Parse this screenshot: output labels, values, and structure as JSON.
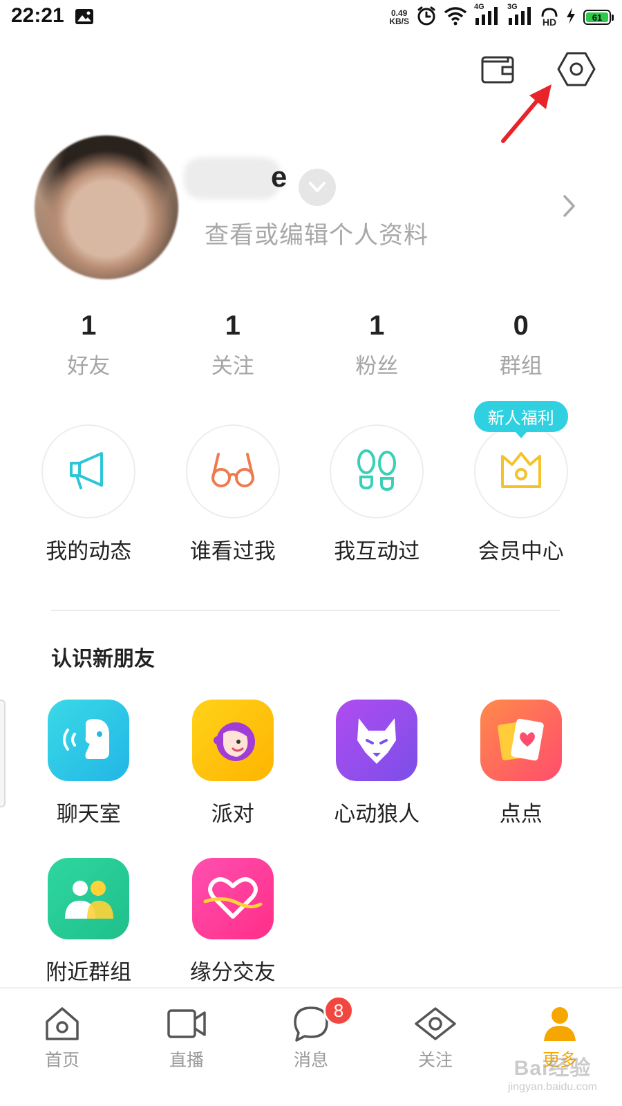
{
  "status_bar": {
    "time": "22:21",
    "net_speed_value": "0.49",
    "net_speed_unit": "KB/S",
    "network_1": "4G",
    "network_2": "3G",
    "hd_label": "HD",
    "battery": "61",
    "icons": [
      "image-icon",
      "alarm-icon",
      "wifi-icon",
      "signal-icon",
      "signal-icon",
      "hd-voice-icon",
      "charging-icon",
      "battery-icon"
    ]
  },
  "top_actions": {
    "icons": [
      "wallet-icon",
      "settings-icon"
    ]
  },
  "profile": {
    "name_visible_suffix": "e",
    "subtitle": "查看或编辑个人资料"
  },
  "stats": [
    {
      "value": "1",
      "label": "好友"
    },
    {
      "value": "1",
      "label": "关注"
    },
    {
      "value": "1",
      "label": "粉丝"
    },
    {
      "value": "0",
      "label": "群组"
    }
  ],
  "quick_actions": [
    {
      "label": "我的动态",
      "icon": "megaphone-icon",
      "color": "#2cc6d8"
    },
    {
      "label": "谁看过我",
      "icon": "glasses-icon",
      "color": "#ee7a4e"
    },
    {
      "label": "我互动过",
      "icon": "footprints-icon",
      "color": "#3ad0b8"
    },
    {
      "label": "会员中心",
      "icon": "crown-icon",
      "color": "#f5c22a",
      "badge": "新人福利"
    }
  ],
  "discover": {
    "title": "认识新朋友",
    "apps": [
      {
        "label": "聊天室",
        "icon": "chatroom-icon"
      },
      {
        "label": "派对",
        "icon": "party-icon"
      },
      {
        "label": "心动狼人",
        "icon": "werewolf-icon"
      },
      {
        "label": "点点",
        "icon": "cards-icon"
      },
      {
        "label": "附近群组",
        "icon": "nearby-groups-icon"
      },
      {
        "label": "缘分交友",
        "icon": "heart-match-icon"
      }
    ]
  },
  "bottom_nav": [
    {
      "label": "首页",
      "icon": "home-icon",
      "active": false
    },
    {
      "label": "直播",
      "icon": "video-icon",
      "active": false
    },
    {
      "label": "消息",
      "icon": "message-icon",
      "active": false,
      "badge": "8"
    },
    {
      "label": "关注",
      "icon": "eye-icon",
      "active": false
    },
    {
      "label": "更多",
      "icon": "person-icon",
      "active": true
    }
  ],
  "colors": {
    "accent": "#f6a600",
    "badge_red": "#f2473e",
    "tooltip_cyan": "#2fd0e0",
    "annotation_red": "#e8232a"
  },
  "watermark": {
    "main": "Bai经验",
    "sub": "jingyan.baidu.com"
  }
}
